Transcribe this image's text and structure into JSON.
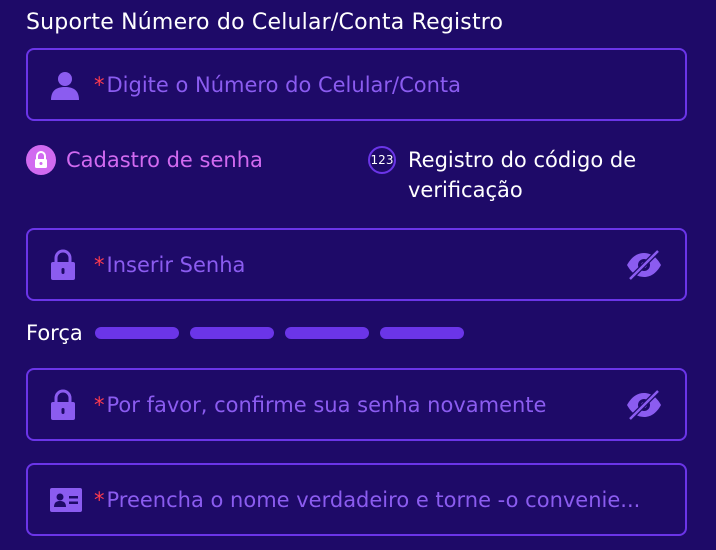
{
  "form": {
    "title": "Suporte Número do Celular/Conta Registro",
    "account_field": {
      "required_mark": "*",
      "placeholder": "Digite o Número do Celular/Conta",
      "icon": "user-icon"
    },
    "tabs": [
      {
        "label": "Cadastro de senha",
        "icon": "lock-icon",
        "active": true
      },
      {
        "label": "Registro do código de verificação",
        "icon_text": "123",
        "active": false
      }
    ],
    "password_field": {
      "required_mark": "*",
      "placeholder": "Inserir Senha",
      "icon": "lock-icon",
      "toggle_icon": "eye-off-icon"
    },
    "strength": {
      "label": "Força",
      "segments": 4
    },
    "confirm_field": {
      "required_mark": "*",
      "placeholder": "Por favor, confirme sua senha novamente",
      "icon": "lock-icon",
      "toggle_icon": "eye-off-icon"
    },
    "name_field": {
      "required_mark": "*",
      "placeholder": "Preencha o nome verdadeiro e torne -o convenie...",
      "icon": "id-card-icon"
    }
  },
  "colors": {
    "background": "#1e0a68",
    "border": "#6b35e8",
    "accent": "#d16af0",
    "placeholder": "#8b5cf0",
    "required": "#ff3b4e"
  }
}
